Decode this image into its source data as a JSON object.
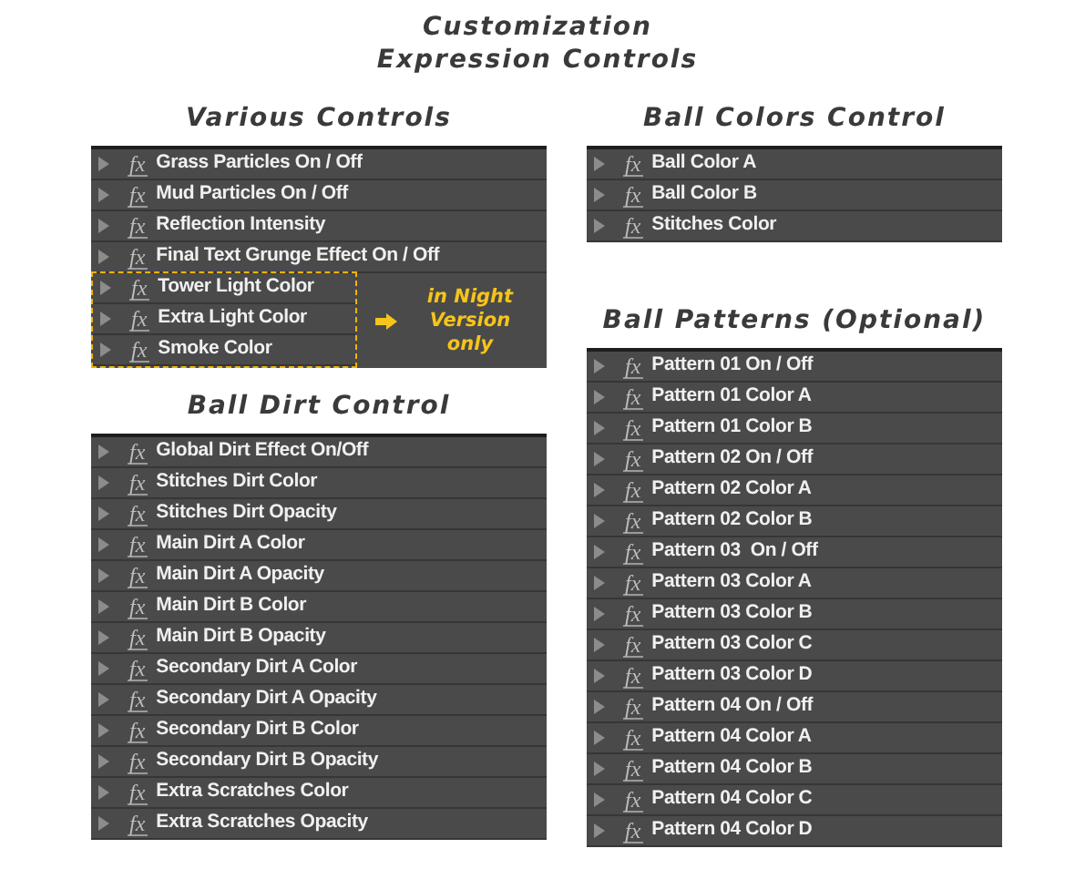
{
  "title": [
    "Customization",
    "Expression Controls"
  ],
  "left_column": [
    {
      "title": "Various Controls",
      "items": [
        {
          "label": "Grass Particles On / Off",
          "badge": "fx",
          "night_only": false
        },
        {
          "label": "Mud Particles On / Off",
          "badge": "fx",
          "night_only": false
        },
        {
          "label": "Reflection Intensity",
          "badge": "fx",
          "night_only": false
        },
        {
          "label": "Final Text Grunge Effect On / Off",
          "badge": "fx",
          "night_only": false
        },
        {
          "label": "Tower Light Color",
          "badge": "fx",
          "night_only": true
        },
        {
          "label": "Extra Light Color",
          "badge": "fx",
          "night_only": true
        },
        {
          "label": "Smoke Color",
          "badge": "fx",
          "night_only": true
        }
      ],
      "note": "in Night Version only"
    },
    {
      "title": "Ball Dirt Control",
      "items": [
        {
          "label": "Global Dirt Effect On/Off",
          "badge": "fx",
          "night_only": false
        },
        {
          "label": "Stitches Dirt Color",
          "badge": "fx",
          "night_only": false
        },
        {
          "label": "Stitches Dirt Opacity",
          "badge": "fx",
          "night_only": false
        },
        {
          "label": "Main Dirt A Color",
          "badge": "fx",
          "night_only": false
        },
        {
          "label": "Main Dirt A Opacity",
          "badge": "fx",
          "night_only": false
        },
        {
          "label": "Main Dirt B Color",
          "badge": "fx",
          "night_only": false
        },
        {
          "label": "Main Dirt B Opacity",
          "badge": "fx",
          "night_only": false
        },
        {
          "label": "Secondary Dirt A Color",
          "badge": "fx",
          "night_only": false
        },
        {
          "label": "Secondary Dirt A Opacity",
          "badge": "fx",
          "night_only": false
        },
        {
          "label": "Secondary Dirt B Color",
          "badge": "fx",
          "night_only": false
        },
        {
          "label": "Secondary Dirt B Opacity",
          "badge": "fx",
          "night_only": false
        },
        {
          "label": "Extra Scratches Color",
          "badge": "fx",
          "night_only": false
        },
        {
          "label": "Extra Scratches Opacity",
          "badge": "fx",
          "night_only": false
        }
      ]
    }
  ],
  "right_column": [
    {
      "title": "Ball Colors Control",
      "items": [
        {
          "label": "Ball Color A",
          "badge": "fx",
          "night_only": false
        },
        {
          "label": "Ball Color B",
          "badge": "fx",
          "night_only": false
        },
        {
          "label": "Stitches Color",
          "badge": "fx",
          "night_only": false
        }
      ]
    },
    {
      "title": "Ball Patterns (Optional)",
      "items": [
        {
          "label": "Pattern 01 On / Off",
          "badge": "fx",
          "night_only": false
        },
        {
          "label": "Pattern 01 Color A",
          "badge": "fx",
          "night_only": false
        },
        {
          "label": "Pattern 01 Color B",
          "badge": "fx",
          "night_only": false
        },
        {
          "label": "Pattern 02 On / Off",
          "badge": "fx",
          "night_only": false
        },
        {
          "label": "Pattern 02 Color A",
          "badge": "fx",
          "night_only": false
        },
        {
          "label": "Pattern 02 Color B",
          "badge": "fx",
          "night_only": false
        },
        {
          "label": "Pattern 03  On / Off",
          "badge": "fx",
          "night_only": false
        },
        {
          "label": "Pattern 03 Color A",
          "badge": "fx",
          "night_only": false
        },
        {
          "label": "Pattern 03 Color B",
          "badge": "fx",
          "night_only": false
        },
        {
          "label": "Pattern 03 Color C",
          "badge": "fx",
          "night_only": false
        },
        {
          "label": "Pattern 03 Color D",
          "badge": "fx",
          "night_only": false
        },
        {
          "label": "Pattern 04 On / Off",
          "badge": "fx",
          "night_only": false
        },
        {
          "label": "Pattern 04 Color A",
          "badge": "fx",
          "night_only": false
        },
        {
          "label": "Pattern 04 Color B",
          "badge": "fx",
          "night_only": false
        },
        {
          "label": "Pattern 04 Color C",
          "badge": "fx",
          "night_only": false
        },
        {
          "label": "Pattern 04 Color D",
          "badge": "fx",
          "night_only": false
        }
      ]
    }
  ]
}
